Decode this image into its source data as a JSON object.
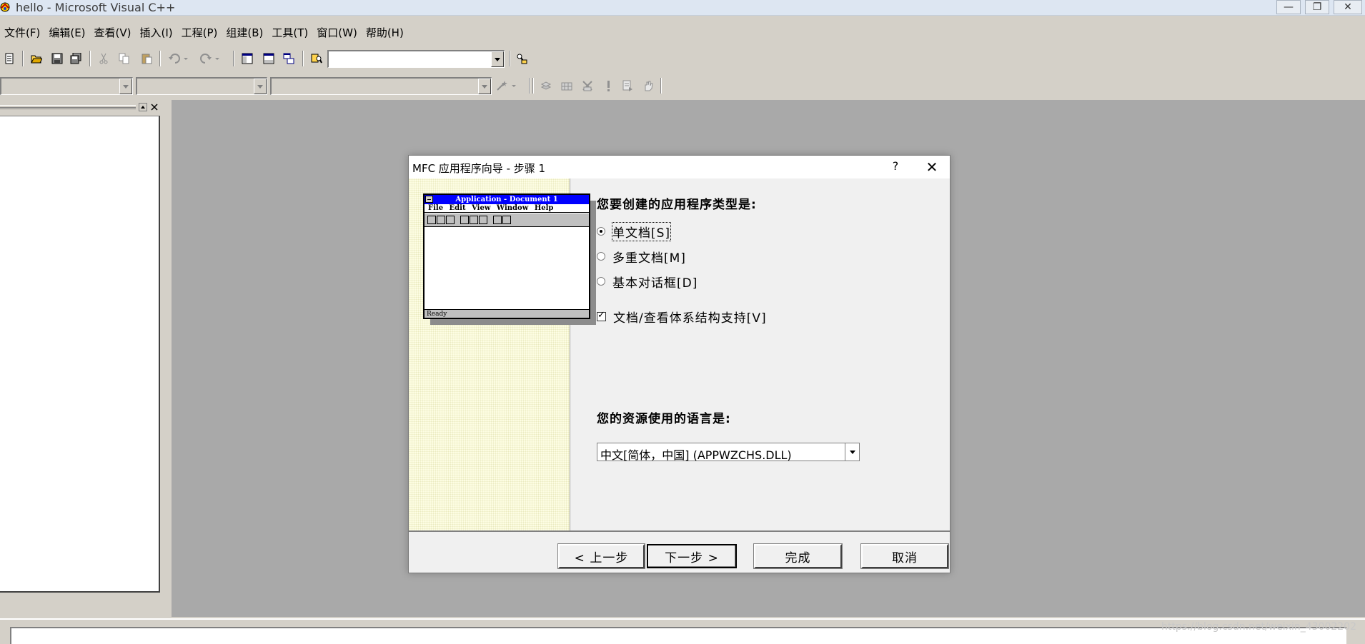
{
  "window": {
    "title": "hello - Microsoft Visual C++",
    "controls": {
      "minimize": "—",
      "restore": "❐",
      "close": "✕"
    }
  },
  "menu": [
    "文件(F)",
    "编辑(E)",
    "查看(V)",
    "插入(I)",
    "工程(P)",
    "组建(B)",
    "工具(T)",
    "窗口(W)",
    "帮助(H)"
  ],
  "toolbar": {
    "icons": [
      "new-text-file-icon",
      "open-icon",
      "save-icon",
      "save-all-icon",
      "cut-icon",
      "copy-icon",
      "paste-icon",
      "undo-icon",
      "redo-icon",
      "workspace-icon",
      "output-icon",
      "window-list-icon",
      "find-in-files-icon",
      "search-icon"
    ],
    "find_combo_value": ""
  },
  "wizardbar": {
    "class_combo": "",
    "filter_combo": "",
    "members_combo": "",
    "icons": [
      "wizard-icon",
      "compile-icon",
      "build-icon",
      "stop-build-icon",
      "execute-icon",
      "go-icon",
      "breakpoint-icon"
    ]
  },
  "dialog": {
    "title": "MFC 应用程序向导 - 步骤 1",
    "help_glyph": "?",
    "close_glyph": "✕",
    "preview": {
      "caption": "Application - Document 1",
      "menu": [
        "File",
        "Edit",
        "View",
        "Window",
        "Help"
      ],
      "status": "Ready"
    },
    "app_type_label": "您要创建的应用程序类型是:",
    "options": [
      {
        "label": "单文档[S]",
        "checked": true
      },
      {
        "label": "多重文档[M]",
        "checked": false
      },
      {
        "label": "基本对话框[D]",
        "checked": false
      }
    ],
    "docview_label": "文档/查看体系结构支持[V]",
    "docview_checked": true,
    "language_label": "您的资源使用的语言是:",
    "language_value": "中文[简体，中国] (APPWZCHS.DLL)",
    "buttons": {
      "back": "< 上一步",
      "next": "下一步 >",
      "finish": "完成",
      "cancel": "取消"
    }
  },
  "watermark": "https://blog.csdn.net/weixin_43002202",
  "colors": {
    "mdi_background": "#a9a9a9",
    "face": "#d4d0c8",
    "preview_caption": "#0000ff"
  }
}
